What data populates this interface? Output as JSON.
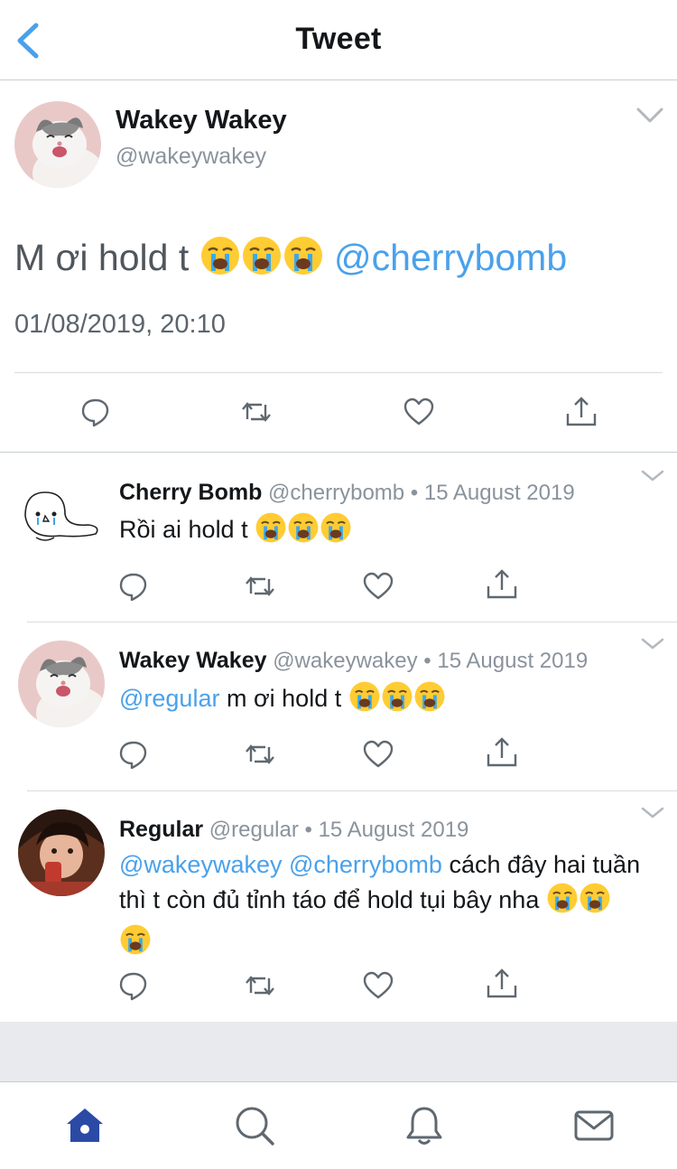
{
  "header": {
    "title": "Tweet"
  },
  "main_tweet": {
    "name": "Wakey Wakey",
    "handle": "@wakeywakey",
    "text_before": "M ơi hold t ",
    "mention": "@cherrybomb",
    "emoji_count": 3,
    "date": "01/08/2019, 20:10"
  },
  "replies": [
    {
      "name": "Cherry Bomb",
      "handle": "@cherrybomb",
      "meta": " • 15 August 2019",
      "mentions": "",
      "text": "Rồi ai hold t "
    },
    {
      "name": "Wakey Wakey",
      "handle": "@wakeywakey",
      "meta": " • 15 August 2019",
      "mentions": "@regular",
      "text": " m ơi hold t "
    },
    {
      "name": "Regular",
      "handle": "@regular",
      "meta": " • 15 August 2019",
      "mentions": "@wakeywakey @cherrybomb",
      "text": " cách đây hai tuần thì t còn đủ tỉnh táo để hold tụi bây nha "
    }
  ],
  "colors": {
    "accent": "#4aa1eb",
    "nav_active": "#2b4aa6",
    "icon_gray": "#5f6870"
  },
  "icons": [
    "back-icon",
    "caret-down-icon",
    "reply-icon",
    "retweet-icon",
    "like-icon",
    "share-icon",
    "crying-emoji-icon",
    "home-icon",
    "search-icon",
    "notifications-icon",
    "messages-icon"
  ]
}
